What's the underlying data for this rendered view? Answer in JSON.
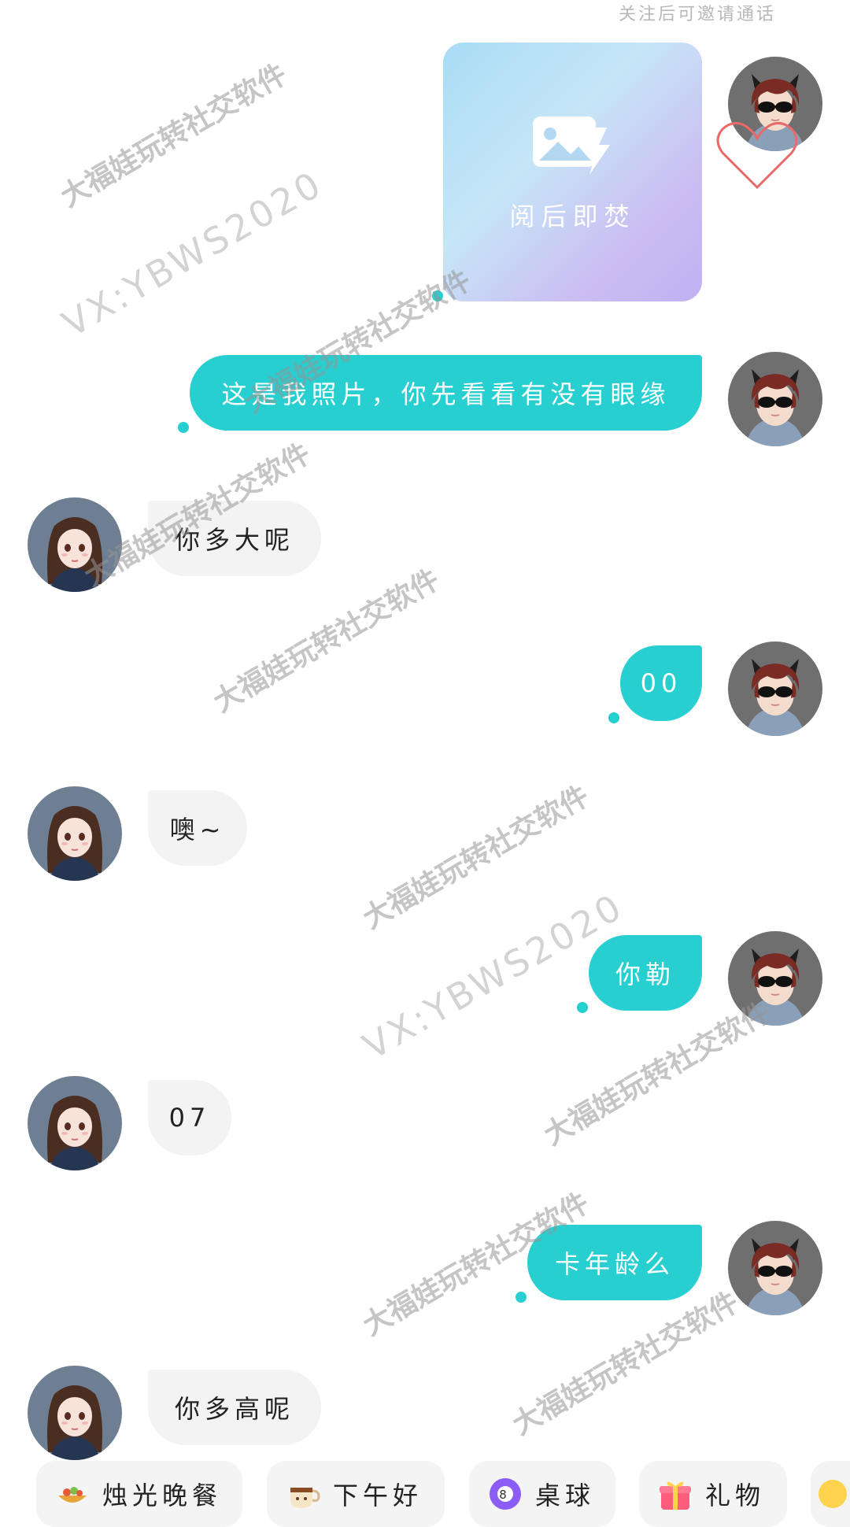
{
  "top_hint": "关注后可邀请通话",
  "burn_after_reading": {
    "label": "阅后即焚"
  },
  "messages": [
    {
      "side": "out",
      "text": "这是我照片，你先看看有没有眼缘"
    },
    {
      "side": "in",
      "text": "你多大呢"
    },
    {
      "side": "out",
      "text": "00"
    },
    {
      "side": "in",
      "text": "噢~"
    },
    {
      "side": "out",
      "text": "你勒"
    },
    {
      "side": "in",
      "text": "07"
    },
    {
      "side": "out",
      "text": "卡年龄么"
    },
    {
      "side": "in",
      "text": "你多高呢"
    }
  ],
  "watermarks": {
    "brand": "大福娃玩转社交软件",
    "contact": "VX:YBWS2020"
  },
  "quick_actions": [
    {
      "label": "烛光晚餐",
      "icon": "candlelight-dinner-icon"
    },
    {
      "label": "下午好",
      "icon": "coffee-cup-icon"
    },
    {
      "label": "桌球",
      "icon": "billiard-ball-icon"
    },
    {
      "label": "礼物",
      "icon": "gift-box-icon"
    }
  ],
  "colors": {
    "outgoing_bubble": "#27cfd1",
    "incoming_bubble": "#f3f3f3",
    "heart_outline": "#e86a6a"
  }
}
